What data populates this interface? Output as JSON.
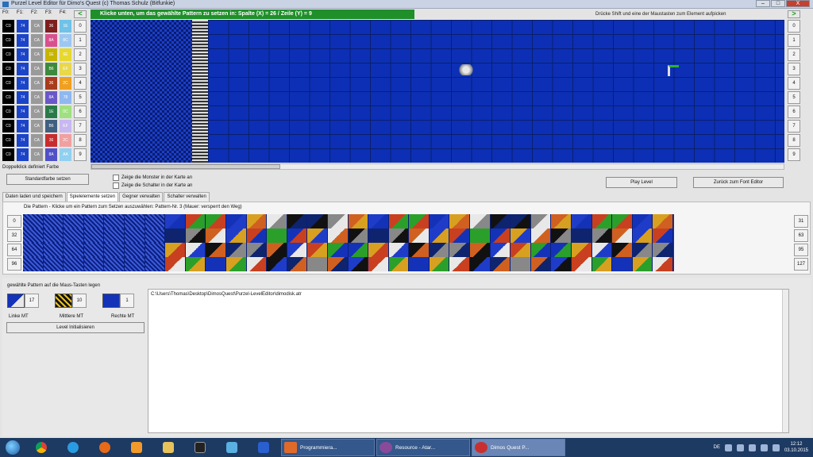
{
  "window": {
    "title": "Purzel Level Editor für Dimo's Quest  (c) Thomas Schulz (Bitfunkie)",
    "buttons": [
      "–",
      "□",
      "X"
    ]
  },
  "palette": {
    "headers": [
      "F0:",
      "F1:",
      "F2:",
      "F3:",
      "F4:"
    ],
    "colors": [
      "#111111",
      "#1f4fd1",
      "#8d8d8d",
      "#8a2a2a",
      "#55b8e6"
    ],
    "rows": [
      [
        "C0",
        "74",
        "CA",
        "36",
        "1E",
        "0"
      ],
      [
        "C0",
        "74",
        "CA",
        "8A",
        "8C",
        "1"
      ],
      [
        "C0",
        "74",
        "CA",
        "1E",
        "6E",
        "2"
      ],
      [
        "C0",
        "74",
        "CA",
        "B6",
        "EF",
        "3"
      ],
      [
        "C0",
        "74",
        "CA",
        "36",
        "2C",
        "4"
      ],
      [
        "C0",
        "74",
        "CA",
        "8A",
        "78",
        "5"
      ],
      [
        "C0",
        "74",
        "CA",
        "1E",
        "0C",
        "6"
      ],
      [
        "C0",
        "74",
        "CA",
        "B6",
        "EF",
        "7"
      ],
      [
        "C0",
        "74",
        "CA",
        "36",
        "2C",
        "8"
      ],
      [
        "C0",
        "74",
        "CA",
        "8A",
        "AA",
        "9"
      ]
    ],
    "row_colors": [
      [
        "#000000",
        "#1b44c8",
        "#9a9a9a",
        "#7e1f1f",
        "#6fc2e8"
      ],
      [
        "#000000",
        "#1b44c8",
        "#9a9a9a",
        "#d85090",
        "#9cc7f2"
      ],
      [
        "#000000",
        "#1b44c8",
        "#9a9a9a",
        "#c6b400",
        "#e6d830"
      ],
      [
        "#000000",
        "#1b44c8",
        "#9a9a9a",
        "#3d8a3d",
        "#e8d84a"
      ],
      [
        "#000000",
        "#1b44c8",
        "#9a9a9a",
        "#a83c1c",
        "#f0a020"
      ],
      [
        "#000000",
        "#1b44c8",
        "#9a9a9a",
        "#6a58c8",
        "#8fb8f0"
      ],
      [
        "#000000",
        "#1b44c8",
        "#9a9a9a",
        "#2a7a48",
        "#a0e080"
      ],
      [
        "#000000",
        "#1b44c8",
        "#9a9a9a",
        "#406080",
        "#c8b8f0"
      ],
      [
        "#000000",
        "#1b44c8",
        "#9a9a9a",
        "#c82d2d",
        "#f0a0a0"
      ],
      [
        "#000000",
        "#1b44c8",
        "#9a9a9a",
        "#5050c8",
        "#90d0f0"
      ]
    ]
  },
  "map": {
    "instruction": "Klicke unten, um das gewählte Pattern zu setzen in:   Spalte (X) = 26  /  Zeile (Y) = 9",
    "hint": "Drücke Shift und eine der Maustasten zum Element aufpicken",
    "row_indices": [
      "0",
      "1",
      "2",
      "3",
      "4",
      "5",
      "6",
      "7",
      "8",
      "9"
    ],
    "nav_left": "<",
    "nav_right": ">"
  },
  "controls": {
    "double_click_hint": "Doppelklick definiert Farbe",
    "default_color_button": "Standardfarbe setzen",
    "show_monsters": "Zeige die Monster in der Karte an",
    "show_switches": "Zeige die Schalter in der Karte an",
    "play_button": "Play Level",
    "font_editor_button": "Zurück zum Font Editor"
  },
  "tabs": [
    {
      "label": "Daten laden und speichern"
    },
    {
      "label": "Spielelemente setzen"
    },
    {
      "label": "Gegner verwalten"
    },
    {
      "label": "Schalter verwalten"
    }
  ],
  "patterns": {
    "header": "Die Pattern - Klicke um ein Pattern zum Setzen auszuwählen:  Pattern-Nr.  3   (Mauer: versperrt den Weg)",
    "row_labels_left": [
      "0",
      "32",
      "64",
      "96"
    ],
    "row_labels_right": [
      "31",
      "63",
      "95",
      "127"
    ]
  },
  "mouse_assignment": {
    "heading": "gewählte  Pattern auf die Maus-Tasten legen",
    "left_num": "17",
    "middle_num": "10",
    "right_num": "1",
    "left_label": "Linke MT",
    "middle_label": "Mittlere MT",
    "right_label": "Rechte MT",
    "init_button": "Level Initialisieren"
  },
  "file_path": "C:\\Users\\Thomas\\Desktop\\DimosQuest\\Purzel-LevelEditor\\dimodisk.atr",
  "taskbar": {
    "tasks": [
      "Programmiera...",
      "Resource - Atar...",
      "Dimos Quest P..."
    ],
    "lang": "DE",
    "time": "12:12",
    "date": "03.10.2015"
  }
}
